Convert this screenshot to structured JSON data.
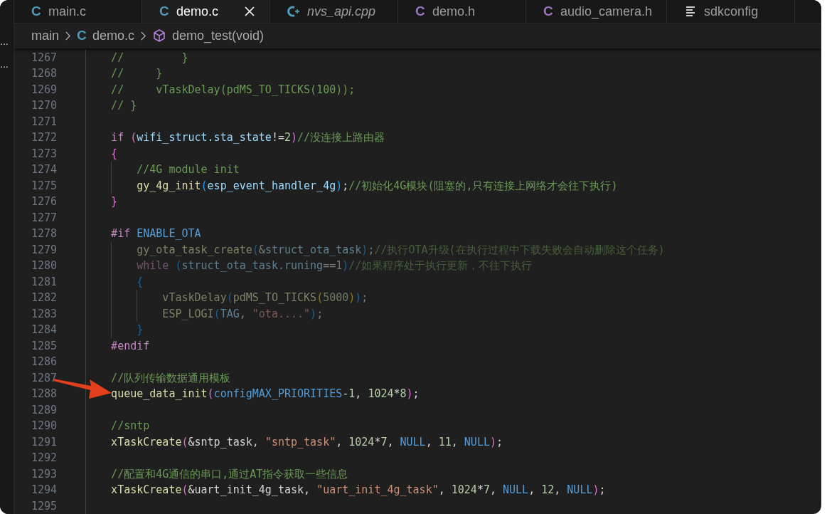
{
  "sidebar_fragments": [
    "...",
    "..."
  ],
  "tabs": [
    {
      "label": "main.c",
      "kind": "c",
      "icon": "C",
      "selected": false,
      "italic": false
    },
    {
      "label": "demo.c",
      "kind": "c",
      "icon": "C",
      "selected": true,
      "italic": false
    },
    {
      "label": "nvs_api.cpp",
      "kind": "cpp",
      "selected": false,
      "italic": true
    },
    {
      "label": "demo.h",
      "kind": "h",
      "icon": "C",
      "selected": false,
      "italic": false
    },
    {
      "label": "audio_camera.h",
      "kind": "h",
      "icon": "C",
      "selected": false,
      "italic": false
    },
    {
      "label": "sdkconfig",
      "kind": "config",
      "selected": false,
      "italic": false
    }
  ],
  "breadcrumb": [
    {
      "label": "main",
      "kind": "folder"
    },
    {
      "label": "demo.c",
      "kind": "c",
      "icon": "C"
    },
    {
      "label": "demo_test(void)",
      "kind": "symbol"
    }
  ],
  "lines": [
    {
      "number": "1267",
      "inactive": false,
      "tokens": [
        {
          "kind": "cm",
          "text": "    //         }"
        }
      ]
    },
    {
      "number": "1268",
      "inactive": false,
      "tokens": [
        {
          "kind": "cm",
          "text": "    //     }"
        }
      ]
    },
    {
      "number": "1269",
      "inactive": false,
      "tokens": [
        {
          "kind": "cm",
          "text": "    //     vTaskDelay(pdMS_TO_TICKS(100));"
        }
      ]
    },
    {
      "number": "1270",
      "inactive": false,
      "tokens": [
        {
          "kind": "cm",
          "text": "    // }"
        }
      ]
    },
    {
      "number": "1271"
    },
    {
      "number": "1272",
      "inactive": false,
      "tokens": [
        {
          "kind": "kw",
          "text": "    if "
        },
        {
          "kind": "b2",
          "text": "("
        },
        {
          "kind": "var",
          "text": "wifi_struct.sta_state"
        },
        {
          "kind": "op",
          "text": "!="
        },
        {
          "kind": "num",
          "text": "2"
        },
        {
          "kind": "b2",
          "text": ")"
        },
        {
          "kind": "cm",
          "text": "//没连接上路由器"
        }
      ]
    },
    {
      "number": "1273",
      "inactive": false,
      "tokens": [
        {
          "kind": "b2",
          "text": "    {"
        }
      ]
    },
    {
      "number": "1274",
      "inactive": false,
      "tokens": [
        {
          "kind": "cm",
          "text": "        //4G module init"
        }
      ]
    },
    {
      "number": "1275",
      "inactive": false,
      "tokens": [
        {
          "kind": "fn",
          "text": "        gy_4g_init"
        },
        {
          "kind": "b3",
          "text": "("
        },
        {
          "kind": "var",
          "text": "esp_event_handler_4g"
        },
        {
          "kind": "b3",
          "text": ")"
        },
        {
          "kind": "op",
          "text": ";"
        },
        {
          "kind": "cm",
          "text": "//初始化4G模块(阻塞的,只有连接上网络才会往下执行)"
        }
      ]
    },
    {
      "number": "1276",
      "inactive": false,
      "tokens": [
        {
          "kind": "b2",
          "text": "    }"
        }
      ]
    },
    {
      "number": "1277"
    },
    {
      "number": "1278",
      "inactive": false,
      "tokens": [
        {
          "kind": "kw",
          "text": "    #if "
        },
        {
          "kind": "macro",
          "text": "ENABLE_OTA"
        }
      ]
    },
    {
      "number": "1279",
      "inactive": true,
      "tokens": [
        {
          "kind": "fn",
          "text": "        gy_ota_task_create"
        },
        {
          "kind": "b3",
          "text": "("
        },
        {
          "kind": "op",
          "text": "&"
        },
        {
          "kind": "var",
          "text": "struct_ota_task"
        },
        {
          "kind": "b3",
          "text": ")"
        },
        {
          "kind": "op",
          "text": ";"
        },
        {
          "kind": "cm",
          "text": "//执行OTA升级(在执行过程中下载失败会自动删除这个任务)"
        }
      ]
    },
    {
      "number": "1280",
      "inactive": true,
      "tokens": [
        {
          "kind": "kw",
          "text": "        while "
        },
        {
          "kind": "b3",
          "text": "("
        },
        {
          "kind": "var",
          "text": "struct_ota_task.runing"
        },
        {
          "kind": "op",
          "text": "=="
        },
        {
          "kind": "num",
          "text": "1"
        },
        {
          "kind": "b3",
          "text": ")"
        },
        {
          "kind": "cm",
          "text": "//如果程序处于执行更新，不往下执行"
        }
      ]
    },
    {
      "number": "1281",
      "inactive": true,
      "tokens": [
        {
          "kind": "b3",
          "text": "        {"
        }
      ]
    },
    {
      "number": "1282",
      "inactive": true,
      "tokens": [
        {
          "kind": "fn",
          "text": "            vTaskDelay"
        },
        {
          "kind": "b3",
          "text": "("
        },
        {
          "kind": "fn",
          "text": "pdMS_TO_TICKS"
        },
        {
          "kind": "b1",
          "text": "("
        },
        {
          "kind": "num",
          "text": "5000"
        },
        {
          "kind": "b1",
          "text": ")"
        },
        {
          "kind": "b3",
          "text": ")"
        },
        {
          "kind": "op",
          "text": ";"
        }
      ]
    },
    {
      "number": "1283",
      "inactive": true,
      "tokens": [
        {
          "kind": "fn",
          "text": "            ESP_LOGI"
        },
        {
          "kind": "b3",
          "text": "("
        },
        {
          "kind": "var",
          "text": "TAG"
        },
        {
          "kind": "op",
          "text": ", "
        },
        {
          "kind": "str",
          "text": "\"ota....\""
        },
        {
          "kind": "b3",
          "text": ")"
        },
        {
          "kind": "op",
          "text": ";"
        }
      ]
    },
    {
      "number": "1284",
      "inactive": true,
      "tokens": [
        {
          "kind": "b3",
          "text": "        }"
        }
      ]
    },
    {
      "number": "1285",
      "inactive": false,
      "tokens": [
        {
          "kind": "kw",
          "text": "    #endif"
        }
      ]
    },
    {
      "number": "1286"
    },
    {
      "number": "1287",
      "inactive": false,
      "tokens": [
        {
          "kind": "cm",
          "text": "    //队列传输数据通用模板"
        }
      ]
    },
    {
      "number": "1288",
      "inactive": false,
      "tokens": [
        {
          "kind": "fn",
          "text": "    queue_data_init"
        },
        {
          "kind": "b2",
          "text": "("
        },
        {
          "kind": "macro",
          "text": "configMAX_PRIORITIES"
        },
        {
          "kind": "op",
          "text": "-"
        },
        {
          "kind": "num",
          "text": "1"
        },
        {
          "kind": "op",
          "text": ", "
        },
        {
          "kind": "num",
          "text": "1024"
        },
        {
          "kind": "op",
          "text": "*"
        },
        {
          "kind": "num",
          "text": "8"
        },
        {
          "kind": "b2",
          "text": ")"
        },
        {
          "kind": "op",
          "text": ";"
        }
      ]
    },
    {
      "number": "1289"
    },
    {
      "number": "1290",
      "inactive": false,
      "tokens": [
        {
          "kind": "cm",
          "text": "    //sntp"
        }
      ]
    },
    {
      "number": "1291",
      "inactive": false,
      "tokens": [
        {
          "kind": "fn",
          "text": "    xTaskCreate"
        },
        {
          "kind": "b2",
          "text": "("
        },
        {
          "kind": "op",
          "text": "&sntp_task, "
        },
        {
          "kind": "str",
          "text": "\"sntp_task\""
        },
        {
          "kind": "op",
          "text": ", "
        },
        {
          "kind": "num",
          "text": "1024"
        },
        {
          "kind": "op",
          "text": "*"
        },
        {
          "kind": "num",
          "text": "7"
        },
        {
          "kind": "op",
          "text": ", "
        },
        {
          "kind": "macro",
          "text": "NULL"
        },
        {
          "kind": "op",
          "text": ", "
        },
        {
          "kind": "num",
          "text": "11"
        },
        {
          "kind": "op",
          "text": ", "
        },
        {
          "kind": "macro",
          "text": "NULL"
        },
        {
          "kind": "b2",
          "text": ")"
        },
        {
          "kind": "op",
          "text": ";"
        }
      ]
    },
    {
      "number": "1292"
    },
    {
      "number": "1293",
      "inactive": false,
      "tokens": [
        {
          "kind": "cm",
          "text": "    //配置和4G通信的串口,通过AT指令获取一些信息"
        }
      ]
    },
    {
      "number": "1294",
      "inactive": false,
      "tokens": [
        {
          "kind": "fn",
          "text": "    xTaskCreate"
        },
        {
          "kind": "b2",
          "text": "("
        },
        {
          "kind": "op",
          "text": "&uart_init_4g_task, "
        },
        {
          "kind": "str",
          "text": "\"uart_init_4g_task\""
        },
        {
          "kind": "op",
          "text": ", "
        },
        {
          "kind": "num",
          "text": "1024"
        },
        {
          "kind": "op",
          "text": "*"
        },
        {
          "kind": "num",
          "text": "7"
        },
        {
          "kind": "op",
          "text": ", "
        },
        {
          "kind": "macro",
          "text": "NULL"
        },
        {
          "kind": "op",
          "text": ", "
        },
        {
          "kind": "num",
          "text": "12"
        },
        {
          "kind": "op",
          "text": ", "
        },
        {
          "kind": "macro",
          "text": "NULL"
        },
        {
          "kind": "b2",
          "text": ")"
        },
        {
          "kind": "op",
          "text": ";"
        }
      ]
    },
    {
      "number": "1295"
    }
  ]
}
